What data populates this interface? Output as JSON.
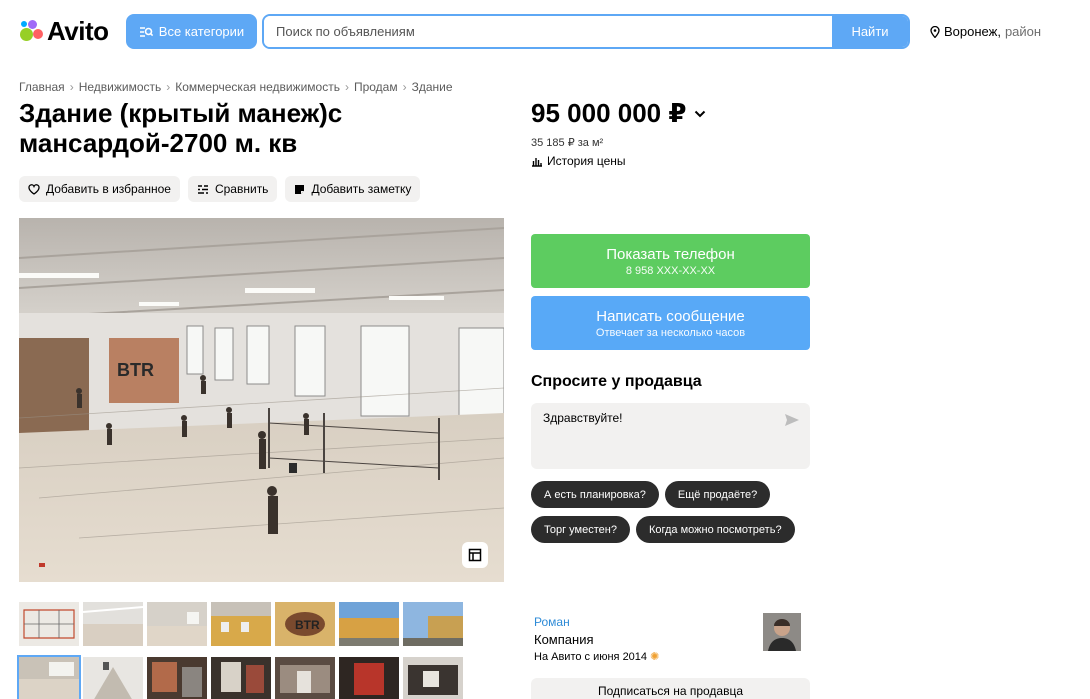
{
  "header": {
    "logo_text": "Avito",
    "categories_label": "Все категории",
    "search_placeholder": "Поиск по объявлениям",
    "search_button": "Найти",
    "location_city": "Воронеж,",
    "location_area": "район"
  },
  "breadcrumb": [
    "Главная",
    "Недвижимость",
    "Коммерческая недвижимость",
    "Продам",
    "Здание"
  ],
  "listing": {
    "title": "Здание (крытый манеж)с мансардой-2700 м. кв",
    "actions": {
      "favorite": "Добавить в избранное",
      "compare": "Сравнить",
      "note": "Добавить заметку"
    },
    "price": "95 000 000 ₽",
    "price_per_meter": "35 185 ₽ за м²",
    "price_history": "История цены"
  },
  "contact": {
    "phone_label": "Показать телефон",
    "phone_masked": "8 958 XXX-XX-XX",
    "message_label": "Написать сообщение",
    "message_sub": "Отвечает за несколько часов"
  },
  "ask": {
    "title": "Спросите у продавца",
    "default_text": "Здравствуйте!",
    "chips": [
      "А есть планировка?",
      "Ещё продаёте?",
      "Торг уместен?",
      "Когда можно посмотреть?"
    ]
  },
  "seller": {
    "name": "Роман",
    "type": "Компания",
    "since": "На Авито с июня 2014",
    "subscribe": "Подписаться на продавца"
  },
  "colors": {
    "accent_blue": "#5ea8f5",
    "phone_green": "#5dcc60",
    "chip_dark": "#2c2c2c"
  },
  "icons": [
    "search-icon",
    "location-pin-icon",
    "heart-icon",
    "compare-icon",
    "note-icon",
    "chevron-down-icon",
    "chart-icon",
    "send-icon",
    "gallery-icon"
  ]
}
